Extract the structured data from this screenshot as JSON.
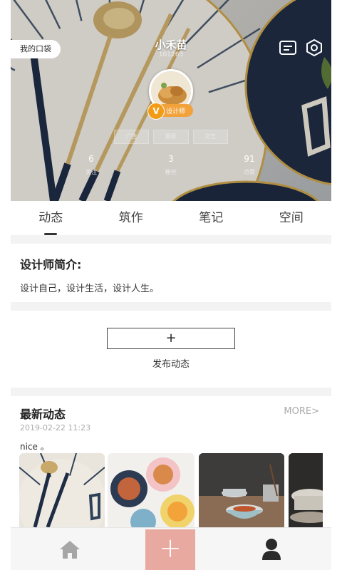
{
  "header": {
    "pocket_label": "我的口袋",
    "nickname": "小禾苗",
    "user_id": "101263",
    "designer_badge": "设计师",
    "v_mark": "V",
    "tags": [
      "广告",
      "摄影",
      "文艺"
    ],
    "stats": [
      {
        "value": "6",
        "label": "关注"
      },
      {
        "value": "3",
        "label": "粉丝"
      },
      {
        "value": "91",
        "label": "点赞"
      }
    ]
  },
  "tabs": [
    "动态",
    "筑作",
    "笔记",
    "空间"
  ],
  "bio": {
    "title": "设计师简介:",
    "text": "设计自己，设计生活，设计人生。"
  },
  "publish": {
    "plus": "+",
    "label": "发布动态"
  },
  "latest": {
    "title": "最新动态",
    "more": "MORE>",
    "date": "2019-02-22 11:23",
    "text": "nice 。"
  },
  "bottom_nav": {
    "add_symbol": "+",
    "icons": [
      "home-icon",
      "add-icon",
      "user-icon"
    ],
    "accent": "#e8a9a0"
  }
}
